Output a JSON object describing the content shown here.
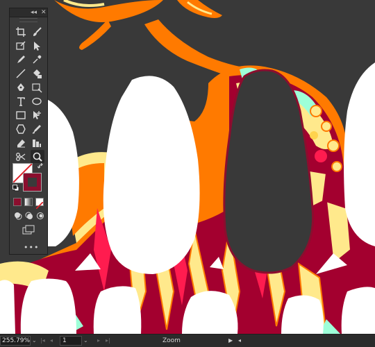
{
  "app": {
    "zoom_level": "255.79%",
    "page_number": "1",
    "status_text": "Zoom"
  },
  "tools_panel": {
    "collapse_glyph": "◂◂",
    "close_glyph": "✕",
    "tools": [
      {
        "name": "artboard-tool-icon"
      },
      {
        "name": "paintbrush-tool-icon"
      },
      {
        "name": "symbol-sprayer-tool-icon"
      },
      {
        "name": "selection-tool-icon"
      },
      {
        "name": "pencil-tool-icon"
      },
      {
        "name": "eyedropper-tool-icon"
      },
      {
        "name": "line-segment-tool-icon"
      },
      {
        "name": "live-paint-bucket-tool-icon"
      },
      {
        "name": "pen-tool-icon"
      },
      {
        "name": "width-tool-icon"
      },
      {
        "name": "type-tool-icon"
      },
      {
        "name": "ellipse-tool-icon"
      },
      {
        "name": "rectangle-tool-icon"
      },
      {
        "name": "anchor-point-tool-icon"
      },
      {
        "name": "shaper-tool-icon"
      },
      {
        "name": "blob-brush-tool-icon"
      },
      {
        "name": "eraser-tool-icon"
      },
      {
        "name": "graph-tool-icon"
      },
      {
        "name": "scissors-tool-icon"
      },
      {
        "name": "zoom-tool-icon"
      }
    ],
    "fill_color": "#ffffff",
    "stroke_color": "#8b0e2e",
    "more_tools_label": "•••"
  },
  "colors": {
    "canvas_background": "#393939",
    "orange": "#ff7a00",
    "yellow": "#ffe98c",
    "crimson": "#a3002f",
    "mint": "#9effd8",
    "selection_stroke": "#8b0e2e"
  },
  "status_bar": {
    "first_glyph": "|◂",
    "prev_glyph": "◂",
    "next_glyph": "▸",
    "last_glyph": "▸|",
    "dropdown_glyph": "⌄",
    "play_glyph": "▶",
    "back_glyph": "◂"
  }
}
